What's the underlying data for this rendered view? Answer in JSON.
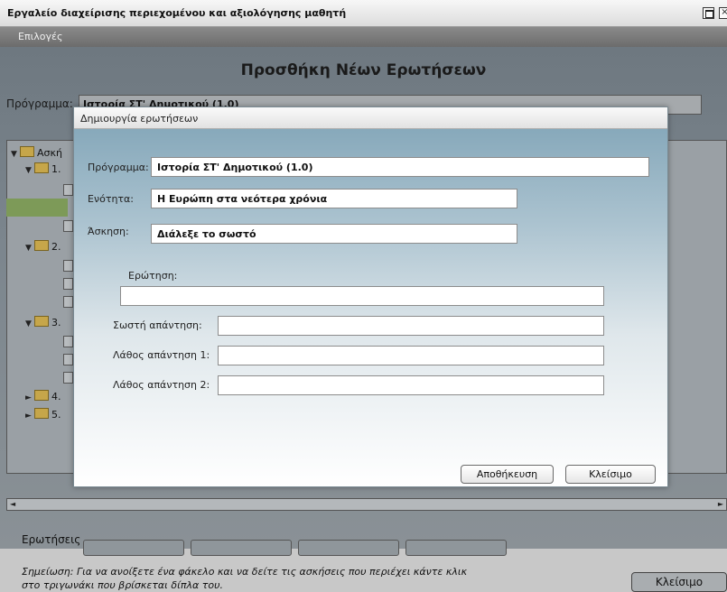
{
  "window": {
    "title": "Εργαλείο διαχείρισης περιεχομένου και αξιολόγησης μαθητή"
  },
  "menu": {
    "options_label": "Επιλογές"
  },
  "main": {
    "heading": "Προσθήκη Νέων Ερωτήσεων",
    "program_label": "Πρόγραμμα:",
    "program_value": "Ιστορία ΣΤ' Δημοτικού (1.0)",
    "tree": {
      "root_label": "Ασκή",
      "items": [
        {
          "label": "1."
        },
        {
          "label": "2."
        },
        {
          "label": "3."
        },
        {
          "label": "4."
        },
        {
          "label": "5."
        }
      ]
    },
    "questions_label": "Ερωτήσεις",
    "note_line1": "Σημείωση: Για να ανοίξετε ένα φάκελο και να δείτε τις ασκήσεις που περιέχει κάντε κλικ",
    "note_line2": "στο τριγωνάκι που βρίσκεται δίπλα του.",
    "close_label": "Κλείσιμο"
  },
  "dialog": {
    "title": "Δημιουργία ερωτήσεων",
    "program_label": "Πρόγραμμα:",
    "program_value": "Ιστορία ΣΤ' Δημοτικού (1.0)",
    "unit_label": "Ενότητα:",
    "unit_value": "Η Ευρώπη στα νεότερα χρόνια",
    "exercise_label": "Άσκηση:",
    "exercise_value": "Διάλεξε το σωστό",
    "question_label": "Ερώτηση:",
    "question_value": "",
    "correct_label": "Σωστή απάντηση:",
    "correct_value": "",
    "wrong1_label": "Λάθος απάντηση 1:",
    "wrong1_value": "",
    "wrong2_label": "Λάθος απάντηση 2:",
    "wrong2_value": "",
    "save_label": "Αποθήκευση",
    "close_label": "Κλείσιμο"
  }
}
